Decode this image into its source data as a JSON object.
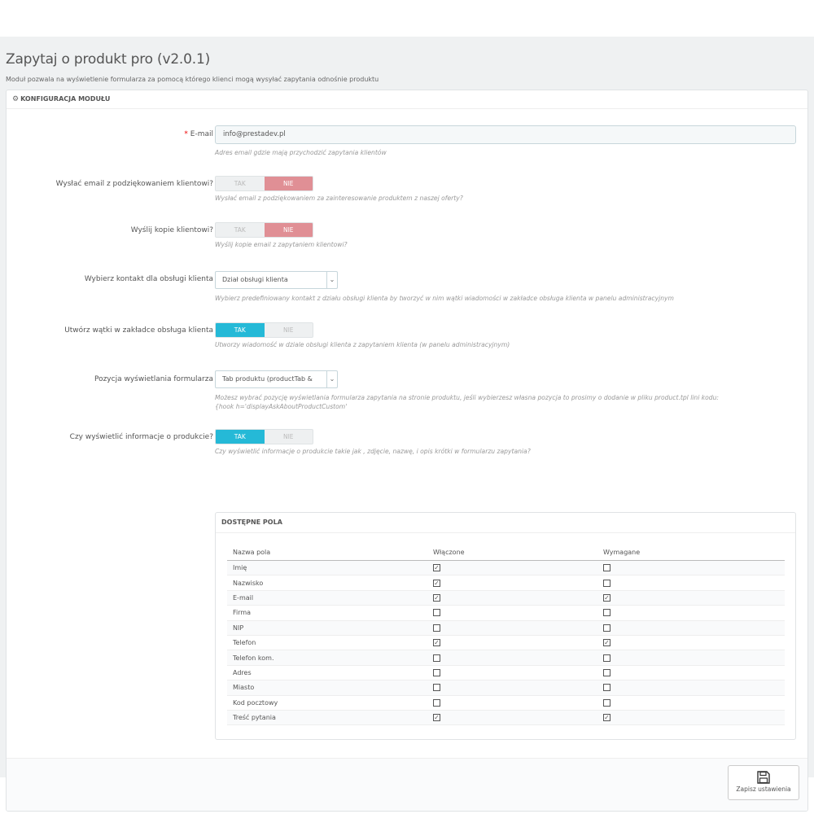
{
  "header": {
    "title": "Zapytaj o produkt pro (v2.0.1)",
    "subtitle": "Moduł pozwala na wyświetlenie formularza za pomocą którego klienci mogą wysyłać zapytania odnośnie produktu"
  },
  "panel": {
    "heading": "KONFIGURACJA MODUŁU",
    "icon": "gears-icon"
  },
  "form": {
    "email": {
      "required_mark": "*",
      "label": "E-mail",
      "value": "info@prestadev.pl",
      "help": "Adres email gdzie mają przychodzić zapytania klientów"
    },
    "send_thanks": {
      "label": "Wysłać email z podziękowaniem klientowi?",
      "yes": "TAK",
      "no": "NIE",
      "selected": "NIE",
      "help": "Wysłać email z podziękowaniem za zainteresowanie produktem z naszej oferty?"
    },
    "send_copy": {
      "label": "Wyślij kopie klientowi?",
      "yes": "TAK",
      "no": "NIE",
      "selected": "NIE",
      "help": "Wyślij kopie email z zapytaniem klientowi?"
    },
    "contact": {
      "label": "Wybierz kontakt dla obsługi klienta",
      "value": "Dział obsługi klienta",
      "help": "Wybierz predefiniowany kontakt z działu obsługi klienta by tworzyć w nim wątki wiadomości w zakładce obsługa klienta w panelu administracyjnym"
    },
    "threads": {
      "label": "Utwórz wątki w zakładce obsługa klienta",
      "yes": "TAK",
      "no": "NIE",
      "selected": "TAK",
      "help": "Utworzy wiadomość w dziale obsługi klienta z zapytaniem klienta (w panelu administracyjnym)"
    },
    "position": {
      "label": "Pozycja wyświetlania formularza",
      "value": "Tab produktu (productTab &",
      "help_line1": "Możesz wybrać pozycję wyświetlania formularza zapytania na stronie produktu, jeśli wybierzesz własna pozycja to prosimy o dodanie w pliku product.tpl lini kodu:",
      "help_line2": "{hook h='displayAskAboutProductCustom'"
    },
    "product_info": {
      "label": "Czy wyświetlić informacje o produkcie?",
      "yes": "TAK",
      "no": "NIE",
      "selected": "TAK",
      "help": "Czy wyświetlić informacje o produkcie takie jak , zdjęcie, nazwę, i opis krótki w formularzu zapytania?"
    }
  },
  "fields": {
    "heading": "DOSTĘPNE POLA",
    "columns": [
      "Nazwa pola",
      "Włączone",
      "Wymagane"
    ],
    "rows": [
      {
        "name": "Imię",
        "enabled": true,
        "required": false
      },
      {
        "name": "Nazwisko",
        "enabled": true,
        "required": false
      },
      {
        "name": "E-mail",
        "enabled": true,
        "required": true
      },
      {
        "name": "Firma",
        "enabled": false,
        "required": false
      },
      {
        "name": "NIP",
        "enabled": false,
        "required": false
      },
      {
        "name": "Telefon",
        "enabled": true,
        "required": true
      },
      {
        "name": "Telefon kom.",
        "enabled": false,
        "required": false
      },
      {
        "name": "Adres",
        "enabled": false,
        "required": false
      },
      {
        "name": "Miasto",
        "enabled": false,
        "required": false
      },
      {
        "name": "Kod pocztowy",
        "enabled": false,
        "required": false
      },
      {
        "name": "Treść pytania",
        "enabled": true,
        "required": true
      }
    ]
  },
  "footer": {
    "save_label": "Zapisz ustawienia",
    "save_icon": "floppy-disk-icon"
  },
  "colors": {
    "switch_yes": "#25b9d7",
    "switch_no": "#e08f95",
    "required": "#ee0000"
  }
}
